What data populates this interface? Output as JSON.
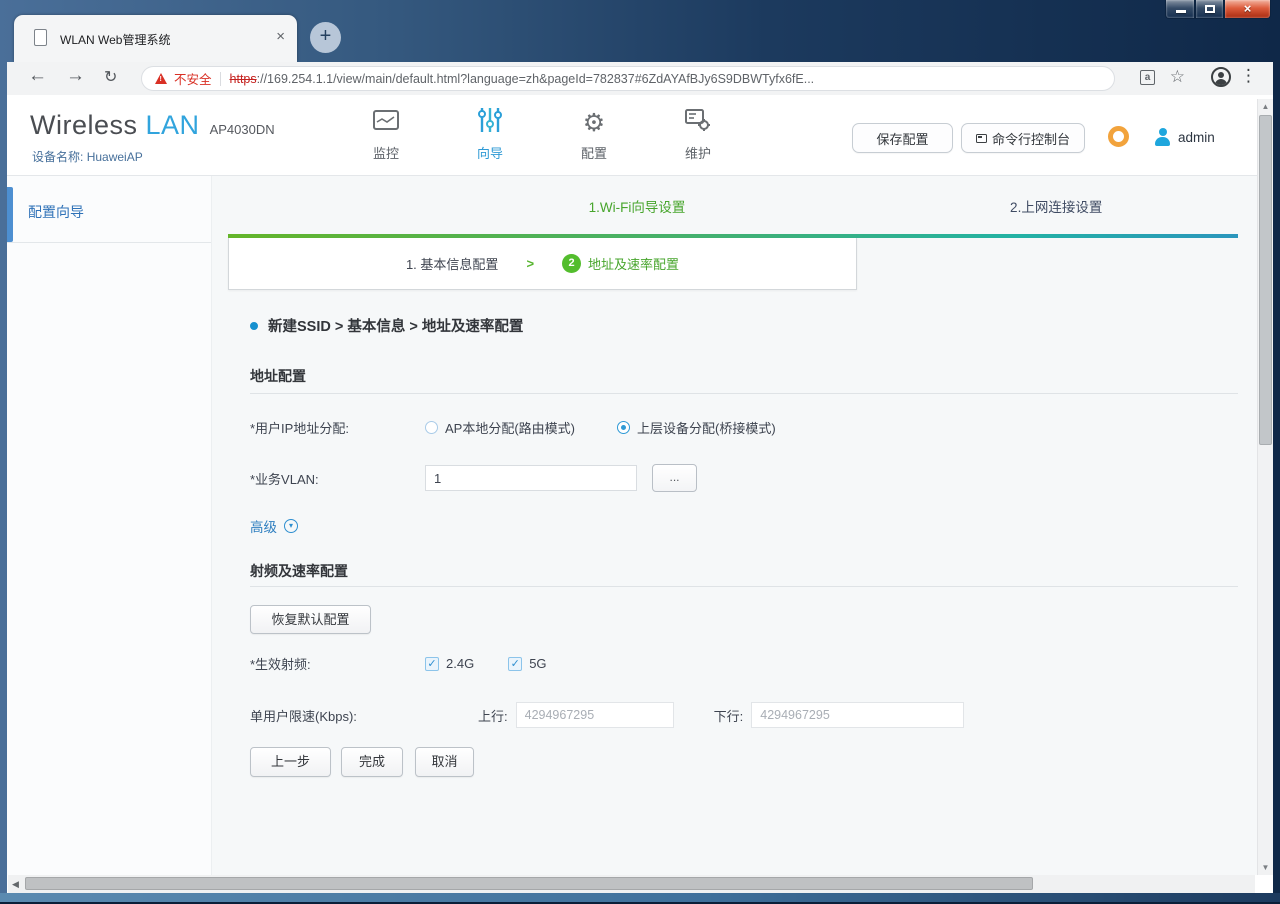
{
  "browser": {
    "tab_title": "WLAN Web管理系统",
    "security_label": "不安全",
    "url_scheme": "https",
    "url_rest": "://169.254.1.1/view/main/default.html?language=zh&pageId=782837#6ZdAYAfBJy6S9DBWTyfx6fE..."
  },
  "icons": {
    "back": "←",
    "forward": "→",
    "reload": "↻",
    "close_tab": "×",
    "new_tab": "+",
    "win_close": "×",
    "warning": "!",
    "translate": "a",
    "star": "☆",
    "menu_dots": "⋮",
    "gear": "⚙",
    "advanced_toggle": "▾",
    "check": "✓",
    "scroll_up": "▲",
    "scroll_down": "▼",
    "scroll_left": "◀"
  },
  "header": {
    "brand_primary": "Wireless",
    "brand_secondary": "LAN",
    "model": "AP4030DN",
    "device_label": "设备名称:",
    "device_name": "HuaweiAP",
    "nav": [
      {
        "label": "监控",
        "active": false
      },
      {
        "label": "向导",
        "active": true
      },
      {
        "label": "配置",
        "active": false
      },
      {
        "label": "维护",
        "active": false
      }
    ],
    "save_label": "保存配置",
    "cli_label": "命令行控制台",
    "username": "admin"
  },
  "sidebar": {
    "item_label": "配置向导"
  },
  "wizard": {
    "stage_tabs": [
      "1.Wi-Fi向导设置",
      "2.上网连接设置"
    ],
    "step1_num": "1.",
    "step1_label": "基本信息配置",
    "step_separator": ">",
    "step2_num": "2",
    "step2_label": "地址及速率配置",
    "breadcrumb": "新建SSID > 基本信息 > 地址及速率配置"
  },
  "form": {
    "section_address": "地址配置",
    "ip_assign": {
      "label": "*用户IP地址分配:",
      "options": [
        {
          "label": "AP本地分配(路由模式)",
          "selected": false
        },
        {
          "label": "上层设备分配(桥接模式)",
          "selected": true
        }
      ]
    },
    "vlan": {
      "label": "*业务VLAN:",
      "value": "1",
      "browse_label": "..."
    },
    "advanced_label": "高级",
    "section_radio": "射频及速率配置",
    "restore_label": "恢复默认配置",
    "effective_radio": {
      "label": "*生效射频:",
      "options": [
        {
          "label": "2.4G",
          "checked": true
        },
        {
          "label": "5G",
          "checked": true
        }
      ]
    },
    "rate_limit": {
      "label": "单用户限速(Kbps):",
      "up_label": "上行:",
      "up_value": "4294967295",
      "down_label": "下行:",
      "down_value": "4294967295"
    },
    "buttons": {
      "prev": "上一步",
      "finish": "完成",
      "cancel": "取消"
    }
  },
  "colors": {
    "accent_blue": "#2f9ad5",
    "brand_blue": "#31a4dd",
    "step_green": "#53bd2d",
    "warning_red": "#d93025",
    "frame_blue": "#1c3a5e"
  }
}
